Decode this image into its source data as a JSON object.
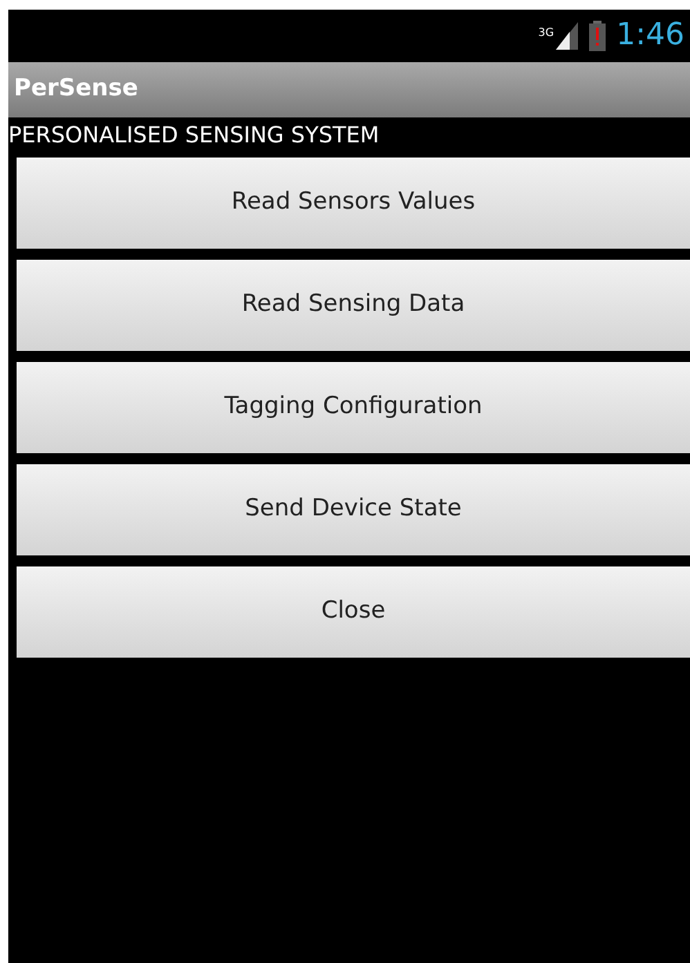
{
  "status_bar": {
    "network": "3G",
    "time": "1:46"
  },
  "app_bar": {
    "title": "PerSense"
  },
  "subtitle": "PERSONALISED SENSING SYSTEM",
  "buttons": [
    "Read Sensors Values",
    "Read Sensing Data",
    "Tagging Configuration",
    "Send Device State",
    "Close"
  ]
}
